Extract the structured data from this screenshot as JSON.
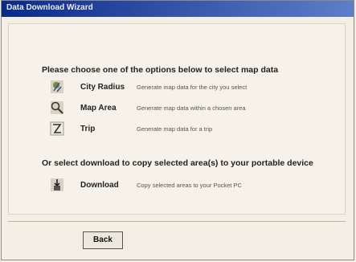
{
  "window": {
    "title": "Data Download Wizard"
  },
  "prompt_map": "Please choose one of the options below to select map data",
  "options": [
    {
      "label": "City Radius",
      "desc": "Generate map data for the city you select"
    },
    {
      "label": "Map Area",
      "desc": "Generate map data within a chosen area"
    },
    {
      "label": "Trip",
      "desc": "Generate map data for a trip"
    }
  ],
  "prompt_download": "Or select download to copy selected area(s) to your portable device",
  "download": {
    "label": "Download",
    "desc": "Copy selected areas to your Pocket PC"
  },
  "buttons": {
    "back": "Back"
  }
}
